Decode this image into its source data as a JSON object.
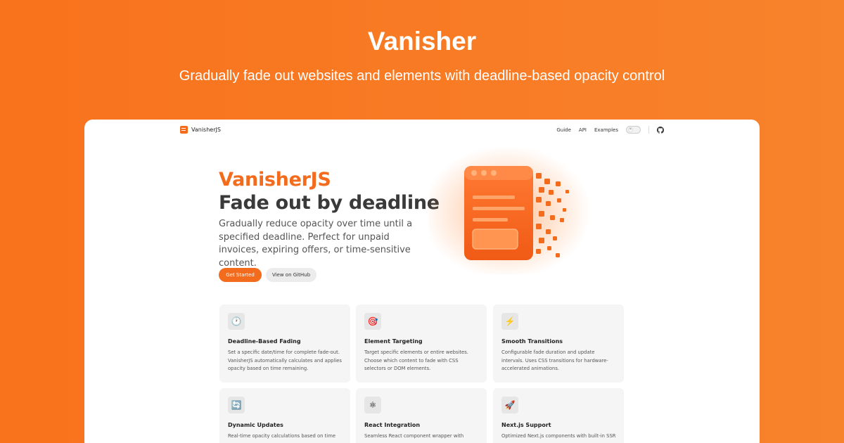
{
  "banner": {
    "title": "Vanisher",
    "subtitle": "Gradually fade out websites and elements with deadline-based opacity control"
  },
  "nav": {
    "logo_text": "VanisherJS",
    "links": [
      "Guide",
      "API",
      "Examples"
    ],
    "toggle_icon": "✕"
  },
  "hero": {
    "brand": "VanisherJS",
    "title": "Fade out by deadline",
    "description": "Gradually reduce opacity over time until a specified deadline. Perfect for unpaid invoices, expiring offers, or time-sensitive content.",
    "primary_button": "Get Started",
    "secondary_button": "View on GitHub"
  },
  "features": [
    {
      "icon": "🕐",
      "icon_name": "clock-icon",
      "title": "Deadline-Based Fading",
      "description": "Set a specific date/time for complete fade-out. VanisherJS automatically calculates and applies opacity based on time remaining."
    },
    {
      "icon": "🎯",
      "icon_name": "target-icon",
      "title": "Element Targeting",
      "description": "Target specific elements or entire websites. Choose which content to fade with CSS selectors or DOM elements."
    },
    {
      "icon": "⚡",
      "icon_name": "lightning-icon",
      "title": "Smooth Transitions",
      "description": "Configurable fade duration and update intervals. Uses CSS transitions for hardware-accelerated animations."
    },
    {
      "icon": "🔄",
      "icon_name": "refresh-icon",
      "title": "Dynamic Updates",
      "description": "Real-time opacity calculations based on time"
    },
    {
      "icon": "⚛",
      "icon_name": "react-icon",
      "title": "React Integration",
      "description": "Seamless React component wrapper with"
    },
    {
      "icon": "🚀",
      "icon_name": "rocket-icon",
      "title": "Next.js Support",
      "description": "Optimized Next.js components with built-in SSR"
    }
  ],
  "colors": {
    "accent": "#f36b1c",
    "background_start": "#f9721c",
    "background_end": "#f7832c"
  }
}
